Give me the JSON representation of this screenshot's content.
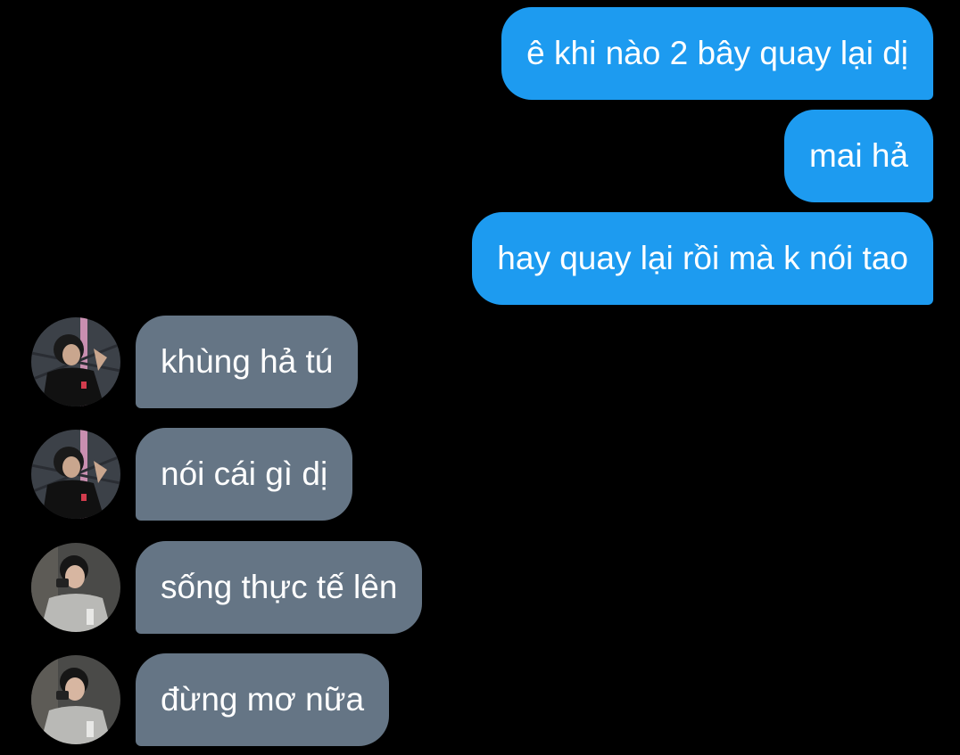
{
  "colors": {
    "background": "#000000",
    "sent_bubble": "#1d9bf0",
    "received_bubble": "#657585",
    "text": "#ffffff"
  },
  "conversation": {
    "sent": [
      {
        "text": "ê khi nào 2 bây quay lại dị"
      },
      {
        "text": "mai hả"
      },
      {
        "text": "hay quay lại rồi mà k nói tao"
      }
    ],
    "received": [
      {
        "text": "khùng hả tú",
        "avatar": "user-a-avatar"
      },
      {
        "text": "nói cái gì dị",
        "avatar": "user-a-avatar"
      },
      {
        "text": "sống thực tế lên",
        "avatar": "user-b-avatar"
      },
      {
        "text": "đừng mơ nữa",
        "avatar": "user-b-avatar"
      }
    ]
  }
}
